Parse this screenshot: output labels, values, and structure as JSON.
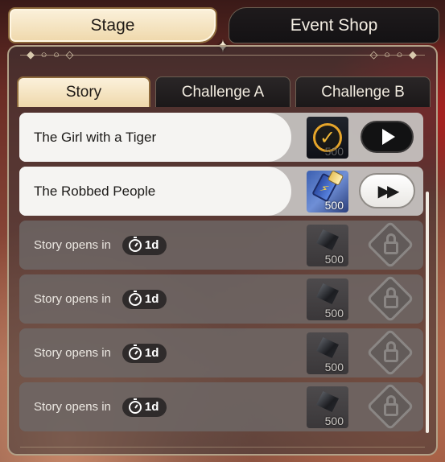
{
  "top_tabs": {
    "stage": "Stage",
    "event_shop": "Event Shop"
  },
  "sub_tabs": {
    "story": "Story",
    "challenge_a": "Challenge A",
    "challenge_b": "Challenge B"
  },
  "stories": [
    {
      "title": "The Girl with a Tiger",
      "status": "completed",
      "reward": "500"
    },
    {
      "title": "The Robbed People",
      "status": "available",
      "reward": "500"
    },
    {
      "title": "Story opens in",
      "status": "locked",
      "timer": "1d",
      "reward": "500"
    },
    {
      "title": "Story opens in",
      "status": "locked",
      "timer": "1d",
      "reward": "500"
    },
    {
      "title": "Story opens in",
      "status": "locked",
      "timer": "1d",
      "reward": "500"
    },
    {
      "title": "Story opens in",
      "status": "locked",
      "timer": "1d",
      "reward": "500"
    }
  ],
  "icons": {
    "completed": "check-icon",
    "play": "play-icon",
    "skip": "fast-forward-icon",
    "locked": "lock-icon",
    "timer": "stopwatch-icon"
  },
  "colors": {
    "active_tab": "#efd8ab",
    "completed_check": "#e6a52a",
    "reward_blue": "#3b5fb0"
  }
}
